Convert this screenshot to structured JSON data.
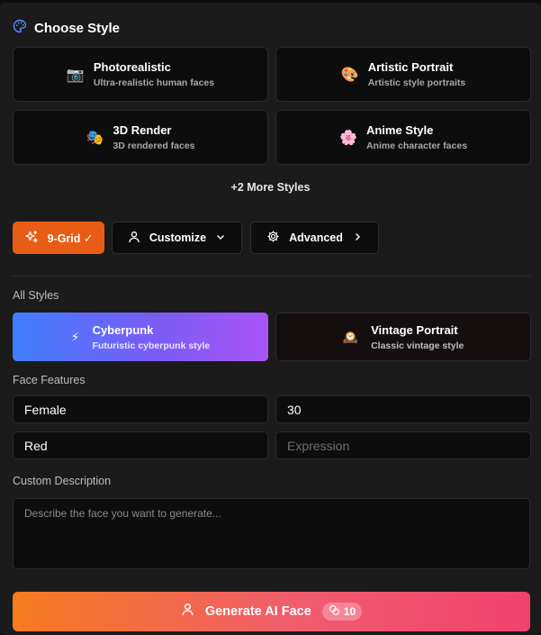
{
  "header": {
    "title": "Choose Style",
    "icon": "palette-icon",
    "icon_color": "#5b8dff"
  },
  "styles": [
    {
      "name": "Photorealistic",
      "desc": "Ultra-realistic human faces",
      "emoji": "📷"
    },
    {
      "name": "Artistic Portrait",
      "desc": "Artistic style portraits",
      "emoji": "🎨"
    },
    {
      "name": "3D Render",
      "desc": "3D rendered faces",
      "emoji": "🎭"
    },
    {
      "name": "Anime Style",
      "desc": "Anime character faces",
      "emoji": "🌸"
    }
  ],
  "more_styles": "+2 More Styles",
  "toolbar": {
    "grid_label": "9-Grid ✓",
    "customize_label": "Customize",
    "advanced_label": "Advanced"
  },
  "all_styles": {
    "label": "All Styles",
    "cards": [
      {
        "name": "Cyberpunk",
        "desc": "Futuristic cyberpunk style",
        "emoji": "⚡",
        "selected": true
      },
      {
        "name": "Vintage Portrait",
        "desc": "Classic vintage style",
        "emoji": "🕰️",
        "selected": false
      }
    ]
  },
  "face_features": {
    "label": "Face Features",
    "gender": "Female",
    "age": "30",
    "hair": "Red",
    "expression_placeholder": "Expression"
  },
  "custom_description": {
    "label": "Custom Description",
    "placeholder": "Describe the face you want to generate..."
  },
  "generate": {
    "label": "Generate AI Face",
    "credits": "10"
  },
  "colors": {
    "accent_orange": "#e85d15",
    "cyber_gradient_start": "#3f7fff",
    "cyber_gradient_end": "#a855f7",
    "generate_gradient_start": "#f77a1e",
    "generate_gradient_end": "#f0436c"
  }
}
